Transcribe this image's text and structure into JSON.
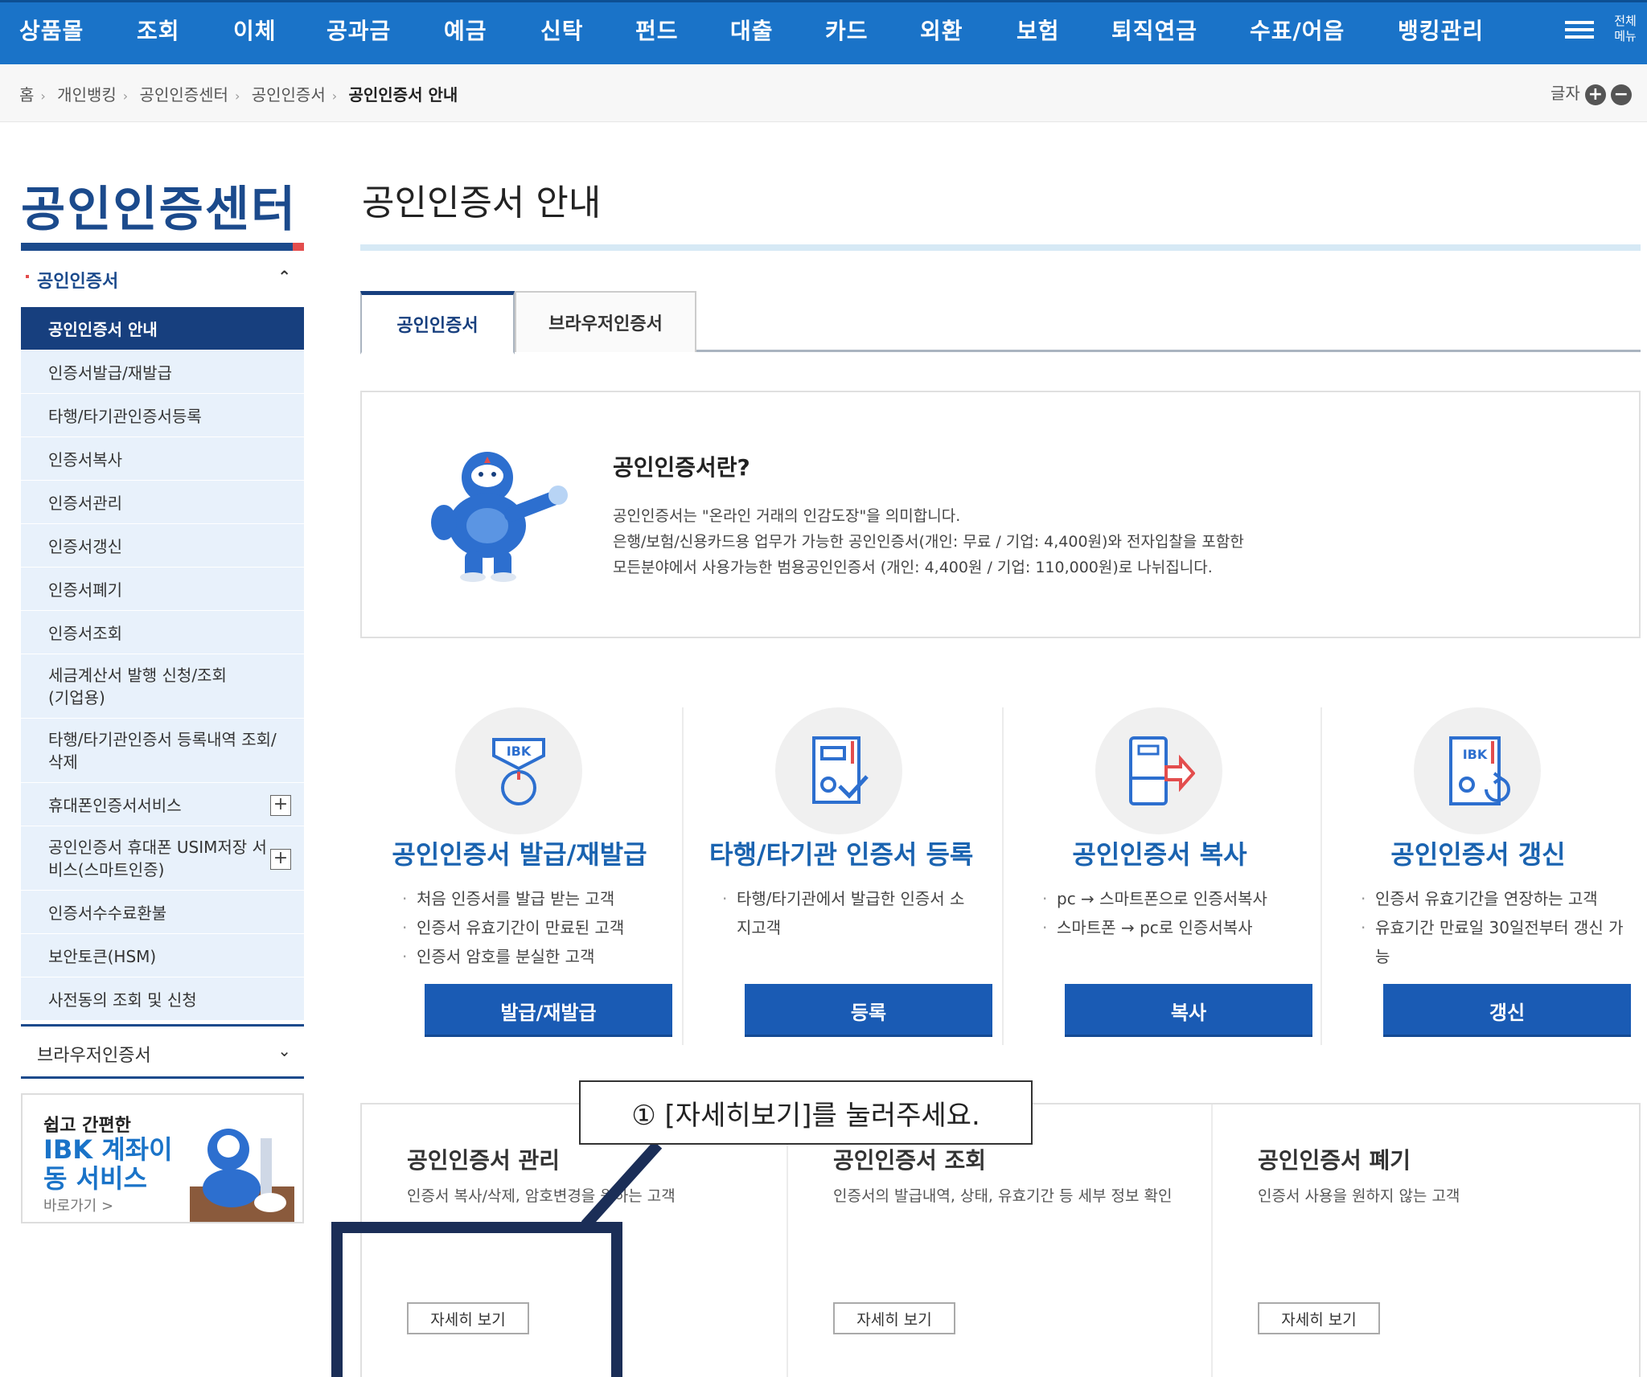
{
  "topnav": {
    "items": [
      "상품몰",
      "조회",
      "이체",
      "공과금",
      "예금",
      "신탁",
      "펀드",
      "대출",
      "카드",
      "외환",
      "보험",
      "퇴직연금",
      "수표/어음",
      "뱅킹관리"
    ],
    "menu_label": "전체 메뉴"
  },
  "breadcrumb": {
    "items": [
      "홈",
      "개인뱅킹",
      "공인인증센터",
      "공인인증서"
    ],
    "current": "공인인증서 안내",
    "font_label": "글자",
    "plus": "+",
    "minus": "−"
  },
  "sidebar": {
    "title": "공인인증센터",
    "section": "공인인증서",
    "section_arrow": "⌃",
    "items": [
      "공인인증서 안내",
      "인증서발급/재발급",
      "타행/타기관인증서등록",
      "인증서복사",
      "인증서관리",
      "인증서갱신",
      "인증서폐기",
      "인증서조회",
      "세금계산서 발행 신청/조회(기업용)",
      "타행/타기관인증서 등록내역 조회/삭제",
      "휴대폰인증서서비스",
      "공인인증서 휴대폰 USIM저장 서비스(스마트인증)",
      "인증서수수료환불",
      "보안토큰(HSM)",
      "사전동의 조회 및 신청"
    ],
    "plus_sign": "+",
    "browser_section": "브라우저인증서",
    "browser_arrow": "⌄",
    "banner": {
      "line1": "쉽고 간편한",
      "line2": "IBK 계좌이동 서비스",
      "link": "바로가기 >"
    }
  },
  "main": {
    "page_title": "공인인증서 안내",
    "tabs": [
      {
        "label": "공인인증서"
      },
      {
        "label": "브라우저인증서"
      }
    ],
    "intro": {
      "title": "공인인증서란?",
      "lines": [
        "공인인증서는 \"온라인 거래의 인감도장\"을 의미합니다.",
        "은행/보험/신용카드용 업무가 가능한 공인인증서(개인: 무료 / 기업: 4,400원)와 전자입찰을 포함한",
        "모든분야에서 사용가능한 범용공인인증서 (개인: 4,400원 / 기업: 110,000원)로 나뉘집니다."
      ]
    },
    "cards": [
      {
        "title": "공인인증서 발급/재발급",
        "desc": [
          "처음 인증서를 발급 받는 고객",
          "인증서 유효기간이 만료된 고객",
          "인증서 암호를 분실한 고객"
        ],
        "button": "발급/재발급"
      },
      {
        "title": "타행/타기관 인증서 등록",
        "desc": [
          "타행/타기관에서 발급한 인증서 소지고객"
        ],
        "button": "등록"
      },
      {
        "title": "공인인증서 복사",
        "desc": [
          "pc → 스마트폰으로 인증서복사",
          "스마트폰 → pc로 인증서복사"
        ],
        "button": "복사"
      },
      {
        "title": "공인인증서 갱신",
        "desc": [
          "인증서 유효기간을 연장하는 고객",
          "유효기간 만료일 30일전부터 갱신 가능"
        ],
        "button": "갱신"
      }
    ],
    "bottom": [
      {
        "title": "공인인증서 관리",
        "desc": "인증서 복사/삭제, 암호변경을 원하는 고객",
        "button": "자세히 보기"
      },
      {
        "title": "공인인증서 조회",
        "desc": "인증서의 발급내역, 상태, 유효기간 등 세부 정보 확인",
        "button": "자세히 보기"
      },
      {
        "title": "공인인증서 폐기",
        "desc": "인증서 사용을 원하지 않는 고객",
        "button": "자세히 보기"
      }
    ]
  },
  "annotation": {
    "callout": "① [자세히보기]를 눌러주세요."
  },
  "colors": {
    "nav_blue": "#1a73c8",
    "navy": "#173f7e",
    "button_blue": "#1a5bb4",
    "highlight": "#1b2e57"
  }
}
